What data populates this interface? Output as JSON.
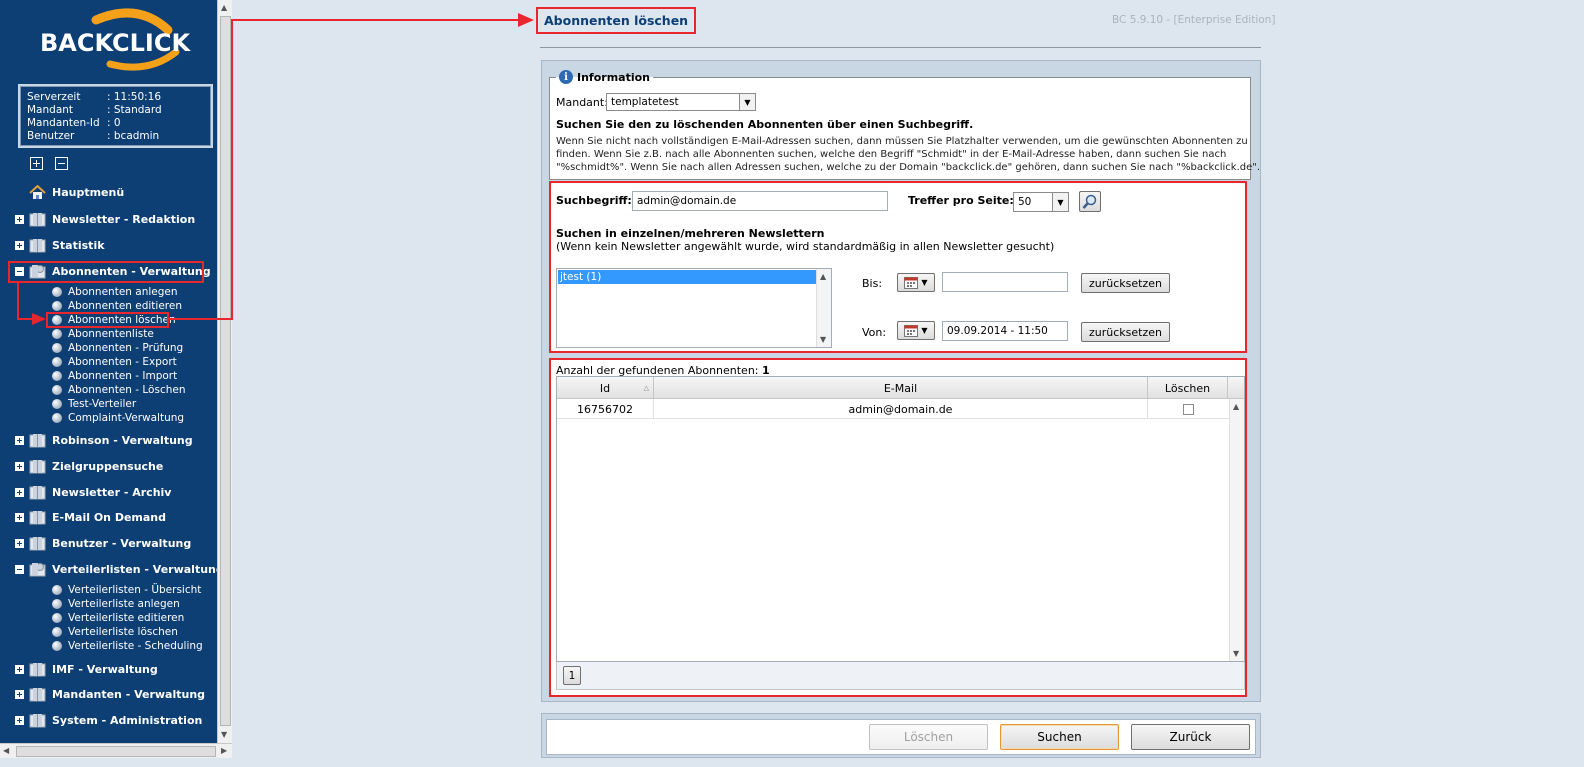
{
  "brand": {
    "logo_text": "BACKCLICK",
    "accent": "#f4a019",
    "sidebar_bg": "#0d3e74",
    "highlight": "#e8262d"
  },
  "info": [
    {
      "label": "Serverzeit",
      "value": ": 11:50:16"
    },
    {
      "label": "Mandant",
      "value": ": Standard"
    },
    {
      "label": "Mandanten-Id",
      "value": ": 0"
    },
    {
      "label": "Benutzer",
      "value": ": bcadmin"
    }
  ],
  "nav": {
    "home": "Hauptmenü",
    "items": [
      {
        "label": "Newsletter - Redaktion"
      },
      {
        "label": "Statistik"
      },
      {
        "label": "Abonnenten - Verwaltung"
      },
      {
        "label": "Robinson - Verwaltung"
      },
      {
        "label": "Zielgruppensuche"
      },
      {
        "label": "Newsletter - Archiv"
      },
      {
        "label": "E-Mail On Demand"
      },
      {
        "label": "Benutzer - Verwaltung"
      },
      {
        "label": "Verteilerlisten - Verwaltung"
      },
      {
        "label": "IMF - Verwaltung"
      },
      {
        "label": "Mandanten - Verwaltung"
      },
      {
        "label": "System - Administration"
      }
    ],
    "abonnenten_sub": [
      "Abonnenten anlegen",
      "Abonnenten editieren",
      "Abonnenten löschen",
      "Abonnentenliste",
      "Abonnenten - Prüfung",
      "Abonnenten - Export",
      "Abonnenten - Import",
      "Abonnenten - Löschen",
      "Test-Verteiler",
      "Complaint-Verwaltung"
    ],
    "verteiler_sub": [
      "Verteilerlisten - Übersicht",
      "Verteilerliste anlegen",
      "Verteilerliste editieren",
      "Verteilerliste löschen",
      "Verteilerliste - Scheduling"
    ]
  },
  "page": {
    "title": "Abonnenten löschen",
    "version": "BC 5.9.10 - [Enterprise Edition]"
  },
  "information": {
    "legend": "Information",
    "mandant_label": "Mandant:",
    "mandant_value": "templatetest",
    "heading": "Suchen Sie den zu löschenden Abonnenten über einen Suchbegriff.",
    "text_line1": "Wenn Sie nicht nach vollständigen E-Mail-Adressen suchen, dann müssen Sie Platzhalter verwenden, um die gewünschten Abonnenten zu",
    "text_line2": "finden. Wenn Sie z.B. nach alle Abonnenten suchen, welche den Begriff \"Schmidt\" in der E-Mail-Adresse haben, dann suchen Sie nach",
    "text_line3": "\"%schmidt%\". Wenn Sie nach allen Adressen suchen, welche zu der Domain \"backclick.de\" gehören, dann suchen Sie nach \"%backclick.de\"."
  },
  "search": {
    "term_label": "Suchbegriff:",
    "term_value": "admin@domain.de",
    "per_page_label": "Treffer pro Seite:",
    "per_page_value": "50",
    "newsletter_heading": "Suchen in einzelnen/mehreren Newslettern",
    "newsletter_hint": "(Wenn kein Newsletter angewählt wurde, wird standardmäßig in allen Newsletter gesucht)",
    "newsletter_items": [
      "jtest (1)"
    ],
    "bis_label": "Bis:",
    "bis_value": "",
    "von_label": "Von:",
    "von_value": "09.09.2014 - 11:50",
    "reset_label": "zurücksetzen"
  },
  "results": {
    "count_label": "Anzahl der gefundenen Abonnenten:",
    "count_value": "1",
    "columns": [
      "Id",
      "E-Mail",
      "Löschen"
    ],
    "rows": [
      {
        "id": "16756702",
        "email": "admin@domain.de",
        "delete": false
      }
    ],
    "page": "1"
  },
  "actions": {
    "delete": "Löschen",
    "search": "Suchen",
    "back": "Zurück"
  }
}
